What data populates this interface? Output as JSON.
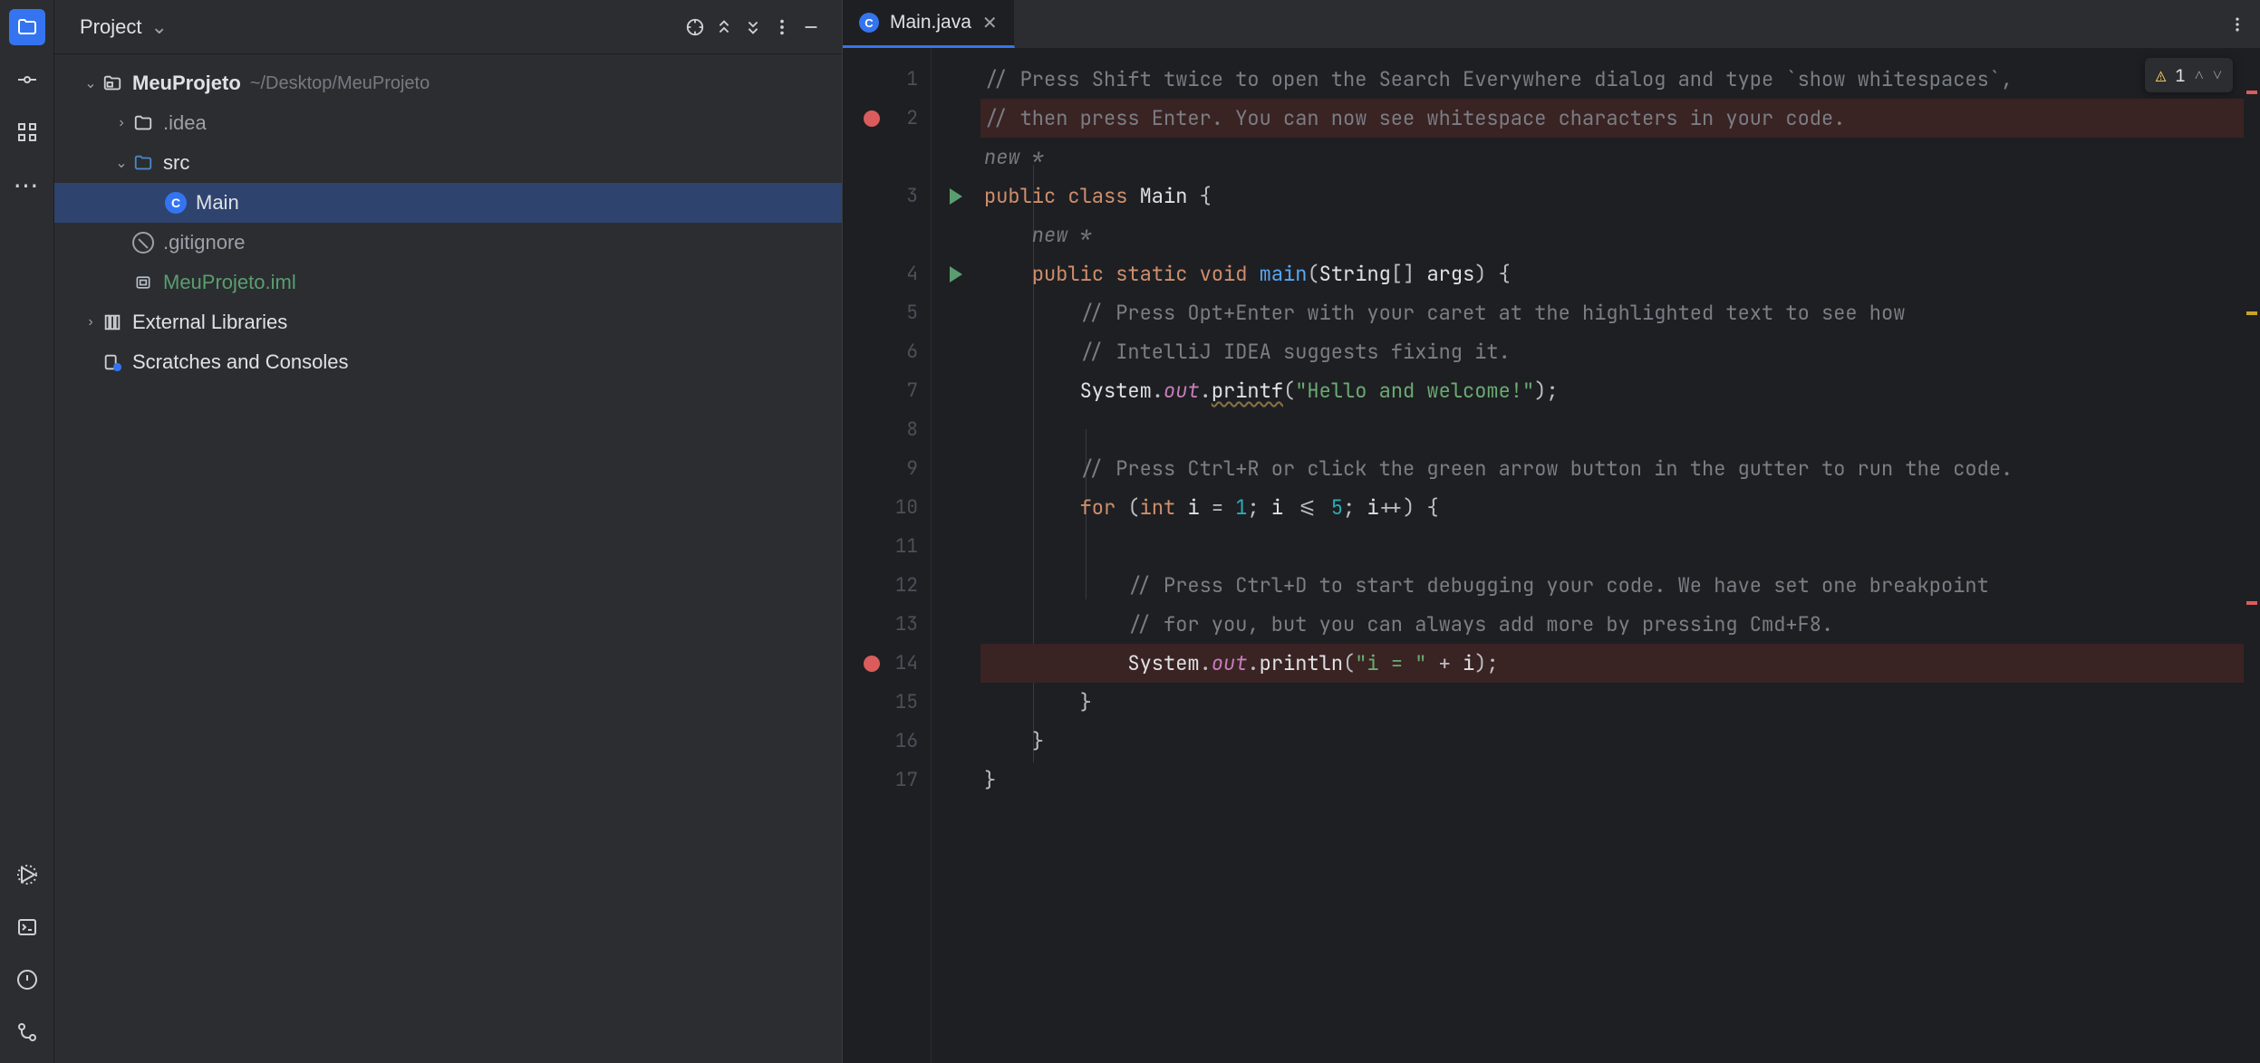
{
  "sidebar": {
    "title": "Project"
  },
  "tree": {
    "root": {
      "name": "MeuProjeto",
      "path": "~/Desktop/MeuProjeto"
    },
    "idea": ".idea",
    "src": "src",
    "main": "Main",
    "gitignore": ".gitignore",
    "iml": "MeuProjeto.iml",
    "ext": "External Libraries",
    "scratch": "Scratches and Consoles"
  },
  "tab": {
    "label": "Main.java"
  },
  "inspection": {
    "warnings": "1"
  },
  "code": {
    "hint_new": "new *",
    "lines": [
      {
        "n": 1,
        "bp": false,
        "tokens": [
          [
            "comment",
            "// Press Shift twice to open the Search Everywhere dialog and type `show whitespaces`,"
          ]
        ]
      },
      {
        "n": 2,
        "bp": true,
        "tokens": [
          [
            "comment",
            "// then press Enter. You can now see whitespace characters in your code."
          ]
        ]
      },
      {
        "n": 3,
        "run": true,
        "hint_above": true,
        "tokens": [
          [
            "kw",
            "public "
          ],
          [
            "kw",
            "class "
          ],
          [
            "class",
            "Main "
          ],
          [
            "punc",
            "{"
          ]
        ]
      },
      {
        "n": 4,
        "run": true,
        "hint_above_inner": true,
        "tokens": [
          [
            "pad",
            "    "
          ],
          [
            "kw",
            "public "
          ],
          [
            "kw",
            "static "
          ],
          [
            "kw",
            "void "
          ],
          [
            "method",
            "main"
          ],
          [
            "punc",
            "("
          ],
          [
            "type",
            "String"
          ],
          [
            "punc",
            "[] "
          ],
          [
            "param",
            "args"
          ],
          [
            "punc",
            ") {"
          ]
        ]
      },
      {
        "n": 5,
        "tokens": [
          [
            "pad",
            "        "
          ],
          [
            "comment",
            "// Press Opt+Enter with your caret at the highlighted text to see how"
          ]
        ]
      },
      {
        "n": 6,
        "tokens": [
          [
            "pad",
            "        "
          ],
          [
            "comment",
            "// IntelliJ IDEA suggests fixing it."
          ]
        ]
      },
      {
        "n": 7,
        "tokens": [
          [
            "pad",
            "        "
          ],
          [
            "type",
            "System"
          ],
          [
            "punc",
            "."
          ],
          [
            "field",
            "out"
          ],
          [
            "punc",
            "."
          ],
          [
            "callwarn",
            "printf"
          ],
          [
            "punc",
            "("
          ],
          [
            "str",
            "\"Hello and welcome!\""
          ],
          [
            "punc",
            ");"
          ]
        ]
      },
      {
        "n": 8,
        "tokens": []
      },
      {
        "n": 9,
        "tokens": [
          [
            "pad",
            "        "
          ],
          [
            "comment",
            "// Press Ctrl+R or click the green arrow button in the gutter to run the code."
          ]
        ]
      },
      {
        "n": 10,
        "tokens": [
          [
            "pad",
            "        "
          ],
          [
            "kw",
            "for "
          ],
          [
            "punc",
            "("
          ],
          [
            "kw",
            "int "
          ],
          [
            "ident",
            "i"
          ],
          [
            "punc",
            " = "
          ],
          [
            "num",
            "1"
          ],
          [
            "punc",
            "; "
          ],
          [
            "ident",
            "i"
          ],
          [
            "punc",
            " <= "
          ],
          [
            "num",
            "5"
          ],
          [
            "punc",
            "; "
          ],
          [
            "ident",
            "i"
          ],
          [
            "punc",
            "++) {"
          ]
        ]
      },
      {
        "n": 11,
        "tokens": []
      },
      {
        "n": 12,
        "tokens": [
          [
            "pad",
            "            "
          ],
          [
            "comment",
            "// Press Ctrl+D to start debugging your code. We have set one breakpoint"
          ]
        ]
      },
      {
        "n": 13,
        "tokens": [
          [
            "pad",
            "            "
          ],
          [
            "comment",
            "// for you, but you can always add more by pressing Cmd+F8."
          ]
        ]
      },
      {
        "n": 14,
        "bp": true,
        "tokens": [
          [
            "pad",
            "            "
          ],
          [
            "type",
            "System"
          ],
          [
            "punc",
            "."
          ],
          [
            "field",
            "out"
          ],
          [
            "punc",
            "."
          ],
          [
            "call",
            "println"
          ],
          [
            "punc",
            "("
          ],
          [
            "str",
            "\"i = \""
          ],
          [
            "punc",
            " + "
          ],
          [
            "ident",
            "i"
          ],
          [
            "punc",
            ");"
          ]
        ]
      },
      {
        "n": 15,
        "tokens": [
          [
            "pad",
            "        "
          ],
          [
            "punc",
            "}"
          ]
        ]
      },
      {
        "n": 16,
        "tokens": [
          [
            "pad",
            "    "
          ],
          [
            "punc",
            "}"
          ]
        ]
      },
      {
        "n": 17,
        "tokens": [
          [
            "punc",
            "}"
          ]
        ]
      }
    ]
  }
}
